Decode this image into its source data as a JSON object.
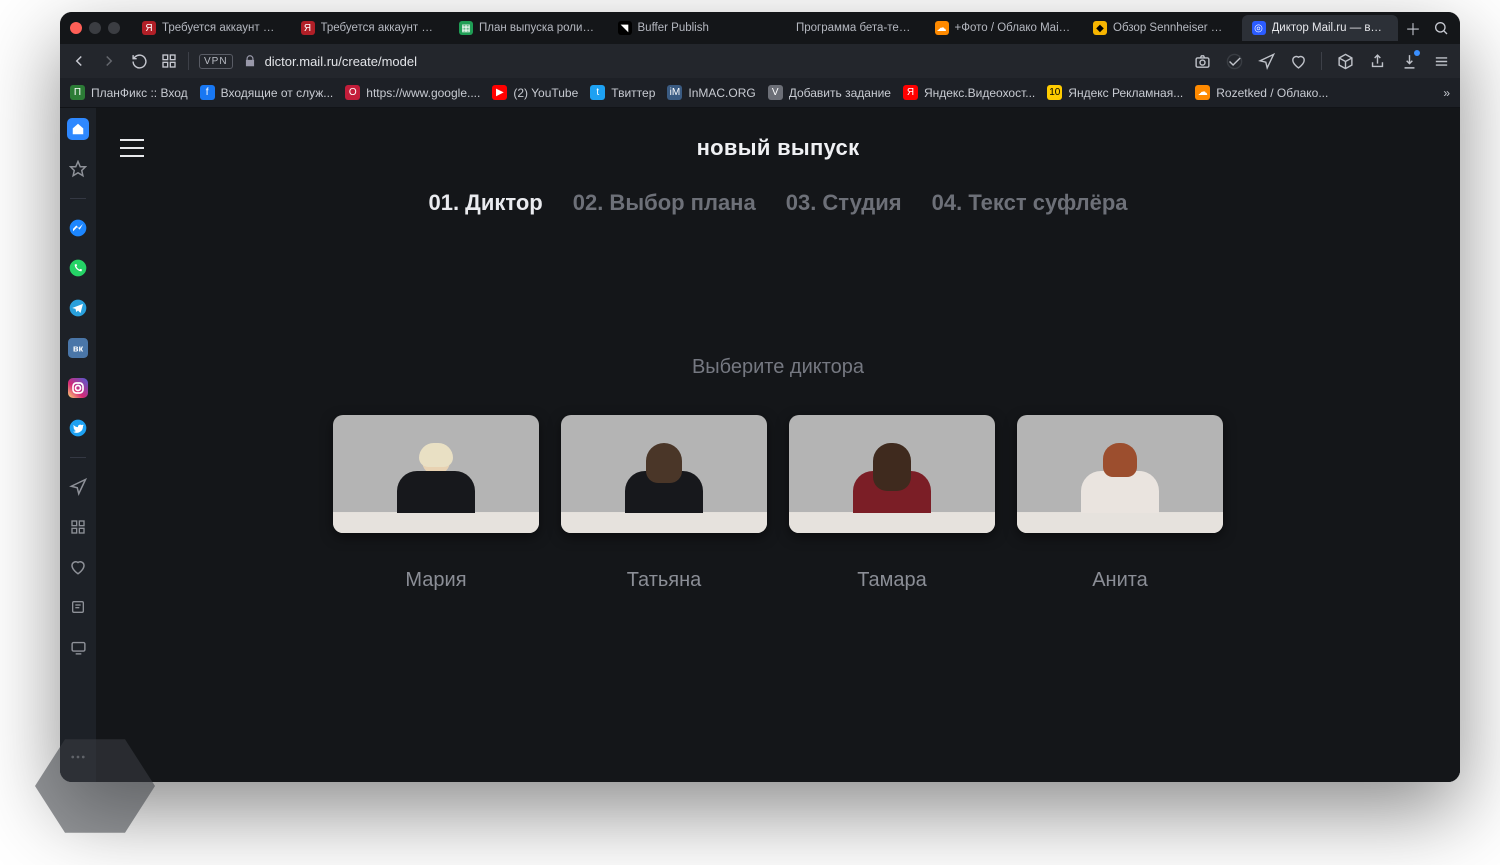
{
  "window": {
    "traffic": {
      "close": "#ff5f57",
      "min": "#28282c",
      "max": "#28282c"
    }
  },
  "tabs": [
    {
      "label": "Требуется аккаунт на Я",
      "icon_bg": "#b11f27"
    },
    {
      "label": "Требуется аккаунт на Я",
      "icon_bg": "#b11f27"
    },
    {
      "label": "План выпуска роликов н",
      "icon_bg": "#1f9e55"
    },
    {
      "label": "Buffer Publish",
      "icon_bg": "#25282e"
    },
    {
      "label": "Программа бета-тестир",
      "icon_bg": "#2d2f34",
      "apple": true
    },
    {
      "label": "+Фото / Облако Mail.ru",
      "icon_bg": "#ff8a00"
    },
    {
      "label": "Обзор Sennheiser Mome",
      "icon_bg": "#f7b500"
    },
    {
      "label": "Диктор Mail.ru — ваш пе",
      "icon_bg": "#3c63ff",
      "active": true
    }
  ],
  "addressbar": {
    "vpn": "VPN",
    "url_text": "dictor.mail.ru/create/model"
  },
  "bookmarks": [
    {
      "label": "ПланФикс :: Вход",
      "icon_bg": "#2c7c36"
    },
    {
      "label": "Входящие от служ...",
      "icon_bg": "#1877f2"
    },
    {
      "label": "https://www.google....",
      "icon_bg": "#c31d3a"
    },
    {
      "label": "(2) YouTube",
      "icon_bg": "#ff0000"
    },
    {
      "label": "Твиттер",
      "icon_bg": "#1da1f2"
    },
    {
      "label": "InMAC.ORG",
      "icon_bg": "#3a5b82"
    },
    {
      "label": "Добавить задание",
      "icon_bg": "#6c6f77"
    },
    {
      "label": "Яндекс.Видеохост...",
      "icon_bg": "#ff0000"
    },
    {
      "label": "Яндекс Рекламная...",
      "icon_bg": "#ffcc00"
    },
    {
      "label": "Rozetked / Облако...",
      "icon_bg": "#ff8a00"
    }
  ],
  "sidebar_icons": [
    "home-icon",
    "star-outline-icon",
    "sep",
    "messenger-icon",
    "whatsapp-icon",
    "telegram-icon",
    "vk-icon",
    "instagram-icon",
    "twitter-icon",
    "sep",
    "send-outline-icon",
    "apps-grid-icon",
    "heart-outline-icon",
    "note-icon",
    "display-icon",
    "more-horizontal-icon"
  ],
  "page": {
    "title": "новый выпуск",
    "steps": [
      {
        "label": "01. Диктор",
        "active": true
      },
      {
        "label": "02. Выбор плана",
        "active": false
      },
      {
        "label": "03. Студия",
        "active": false
      },
      {
        "label": "04. Текст суфлёра",
        "active": false
      }
    ],
    "choose_label": "Выберите диктора",
    "presenters": [
      {
        "name": "Мария"
      },
      {
        "name": "Татьяна"
      },
      {
        "name": "Тамара"
      },
      {
        "name": "Анита"
      }
    ]
  }
}
